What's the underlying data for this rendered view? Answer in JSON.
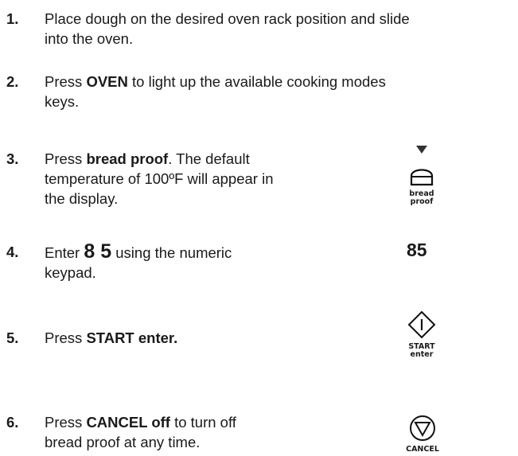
{
  "steps": [
    {
      "number": "1.",
      "lines": [
        "Place dough on the desired oven rack position and slide",
        "into the oven."
      ]
    },
    {
      "number": "2.",
      "pre": "Press ",
      "bold": "OVEN",
      "post": " to light up the available cooking modes",
      "line2": "keys."
    },
    {
      "number": "3.",
      "pre": "Press ",
      "bold": "bread proof",
      "post": ". The default",
      "line2": "temperature of 100ºF will appear in",
      "line3": "the display."
    },
    {
      "number": "4.",
      "pre": "Enter ",
      "bold": "8 5",
      "post": " using the numeric",
      "line2": "keypad."
    },
    {
      "number": "5.",
      "pre": "Press ",
      "bold": "START enter."
    },
    {
      "number": "6.",
      "pre": "Press ",
      "bold": "CANCEL off",
      "post": " to turn off",
      "line2": "bread proof at any time."
    }
  ],
  "icons": {
    "bread_proof": {
      "line1": "bread",
      "line2": "proof",
      "icon": "bread-icon"
    },
    "keypad_value": "85",
    "start": {
      "line1": "START",
      "line2": "enter",
      "icon": "start-diamond-icon"
    },
    "cancel": {
      "line1": "CANCEL",
      "icon": "cancel-triangle-icon"
    },
    "indicator": "down-arrow-icon"
  }
}
